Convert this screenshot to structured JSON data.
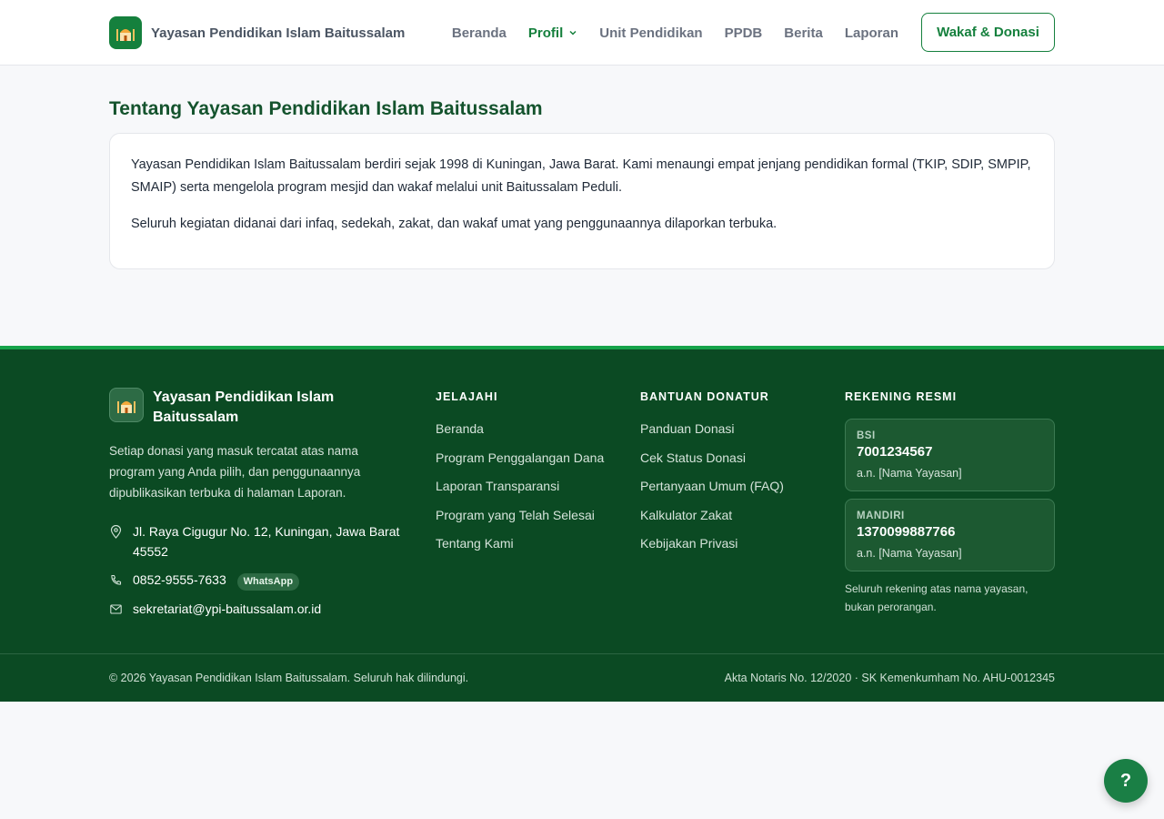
{
  "header": {
    "brand_name": "Yayasan Pendidikan Islam Baitussalam",
    "nav": [
      {
        "label": "Beranda"
      },
      {
        "label": "Profil"
      },
      {
        "label": "Unit Pendidikan"
      },
      {
        "label": "PPDB"
      },
      {
        "label": "Berita"
      },
      {
        "label": "Laporan"
      }
    ],
    "active_nav": "Profil",
    "cta_label": "Wakaf & Donasi"
  },
  "main": {
    "title": "Tentang Yayasan Pendidikan Islam Baitussalam",
    "paragraphs": [
      "Yayasan Pendidikan Islam Baitussalam berdiri sejak 1998 di Kuningan, Jawa Barat. Kami menaungi empat jenjang pendidikan formal (TKIP, SDIP, SMPIP, SMAIP) serta mengelola program mesjid dan wakaf melalui unit Baitussalam Peduli.",
      "Seluruh kegiatan didanai dari infaq, sedekah, zakat, dan wakaf umat yang penggunaannya dilaporkan terbuka."
    ]
  },
  "footer": {
    "brand_name": "Yayasan Pendidikan Islam Baitussalam",
    "description": "Setiap donasi yang masuk tercatat atas nama program yang Anda pilih, dan penggunaannya dipublikasikan terbuka di halaman Laporan.",
    "address": "Jl. Raya Cigugur No. 12, Kuningan, Jawa Barat 45552",
    "phone": "0852-9555-7633",
    "whatsapp_badge": "WhatsApp",
    "email": "sekretariat@ypi-baitussalam.or.id",
    "explore": {
      "heading": "JELAJAHI",
      "links": [
        "Beranda",
        "Program Penggalangan Dana",
        "Laporan Transparansi",
        "Program yang Telah Selesai",
        "Tentang Kami"
      ]
    },
    "donor_help": {
      "heading": "BANTUAN DONATUR",
      "links": [
        "Panduan Donasi",
        "Cek Status Donasi",
        "Pertanyaan Umum (FAQ)",
        "Kalkulator Zakat",
        "Kebijakan Privasi"
      ]
    },
    "accounts": {
      "heading": "REKENING RESMI",
      "items": [
        {
          "bank": "BSI",
          "number": "7001234567",
          "holder": "a.n. [Nama Yayasan]"
        },
        {
          "bank": "MANDIRI",
          "number": "1370099887766",
          "holder": "a.n. [Nama Yayasan]"
        }
      ],
      "note": "Seluruh rekening atas nama yayasan, bukan perorangan."
    },
    "copyright": "© 2026 Yayasan Pendidikan Islam Baitussalam. Seluruh hak dilindungi.",
    "legal": "Akta Notaris No. 12/2020 · SK Kemenkumham No. AHU-0012345"
  },
  "help_button": "?",
  "colors": {
    "brand_green": "#15803d",
    "footer_bg": "#0b4a23",
    "title_green": "#14532d",
    "page_bg": "#f7f8fa"
  }
}
